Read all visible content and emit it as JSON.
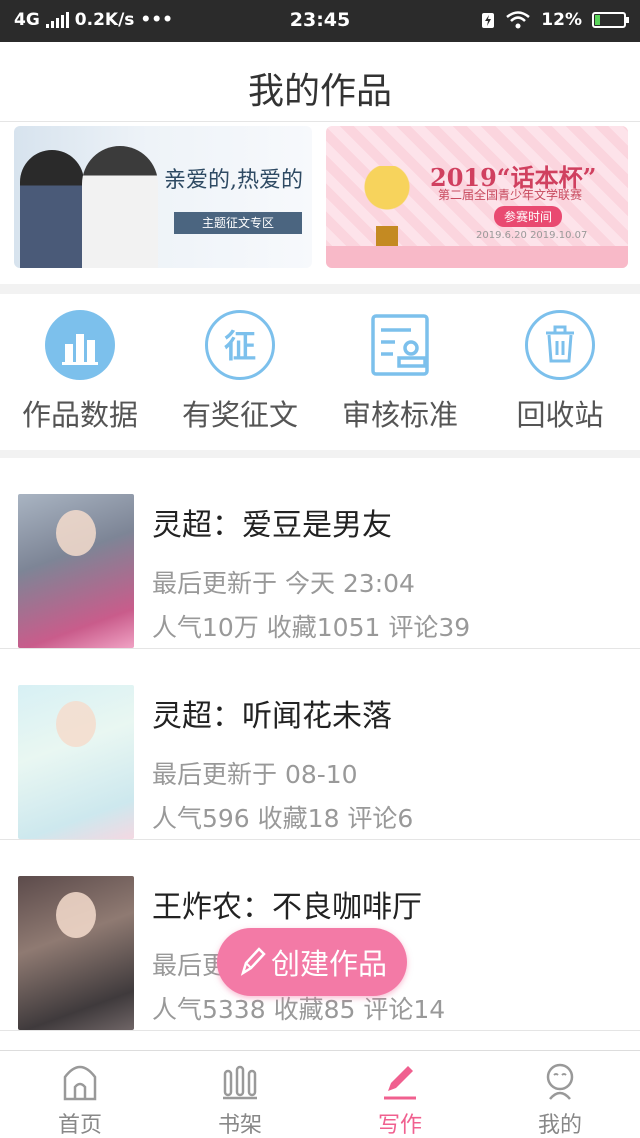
{
  "status_bar": {
    "network": "4G",
    "speed": "0.2K/s",
    "dots": "•••",
    "time": "23:45",
    "battery_percent": "12%",
    "battery_level": 0.12
  },
  "header": {
    "title": "我的作品"
  },
  "banners": {
    "left": {
      "title": "亲爱的,热爱的",
      "subtitle": "主题征文专区"
    },
    "right": {
      "title": "2019“话本杯”",
      "subtitle": "第二届全国青少年文学联赛",
      "badge": "参赛时间",
      "dates": "2019.6.20    2019.10.07"
    }
  },
  "quick_actions": [
    {
      "label": "作品数据",
      "icon": "chart-icon"
    },
    {
      "label": "有奖征文",
      "icon": "contest-icon"
    },
    {
      "label": "审核标准",
      "icon": "review-standard-icon"
    },
    {
      "label": "回收站",
      "icon": "trash-icon"
    }
  ],
  "works": [
    {
      "title": "灵超：爱豆是男友",
      "updated": "最后更新于 今天 23:04",
      "stats": "人气10万 收藏1051 评论39"
    },
    {
      "title": "灵超：听闻花未落",
      "updated": "最后更新于 08-10",
      "stats": "人气596 收藏18 评论6"
    },
    {
      "title": "王炸农：不良咖啡厅",
      "updated": "最后更",
      "stats": "人气5338 收藏85 评论14"
    }
  ],
  "create_button": {
    "label": "创建作品",
    "icon": "pencil-icon"
  },
  "tabbar": {
    "items": [
      {
        "label": "首页",
        "icon": "home-icon"
      },
      {
        "label": "书架",
        "icon": "bookshelf-icon"
      },
      {
        "label": "写作",
        "icon": "pen-icon"
      },
      {
        "label": "我的",
        "icon": "profile-icon"
      }
    ],
    "active": "写作"
  },
  "colors": {
    "accent": "#f0608f",
    "icon_blue": "#7cc0ec",
    "status_bar": "#2b2b2b",
    "create_button": "#f37aa6"
  }
}
